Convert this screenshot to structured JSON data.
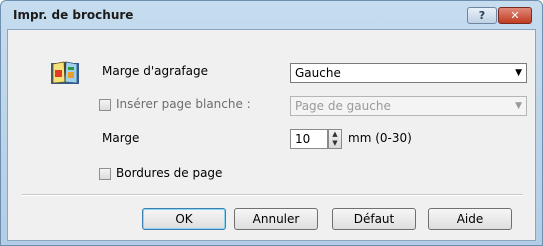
{
  "window": {
    "title": "Impr. de brochure",
    "help_glyph": "?",
    "close_glyph": "✕"
  },
  "icon": "brochure-book-icon",
  "marge_agrafage": {
    "label": "Marge d'agrafage",
    "value": "Gauche"
  },
  "inserer_page_blanche": {
    "label": "Insérer page blanche :",
    "checked": false,
    "value": "Page de gauche"
  },
  "marge": {
    "label": "Marge",
    "value": "10",
    "unit": "mm (0-30)"
  },
  "bordures_de_page": {
    "label": "Bordures de page",
    "checked": false
  },
  "buttons": {
    "ok": "OK",
    "annuler": "Annuler",
    "defaut": "Défaut",
    "aide": "Aide"
  },
  "colors": {
    "titlebar": "#b9d1ea",
    "client": "#f0f0f0",
    "close_button": "#c74a33"
  }
}
